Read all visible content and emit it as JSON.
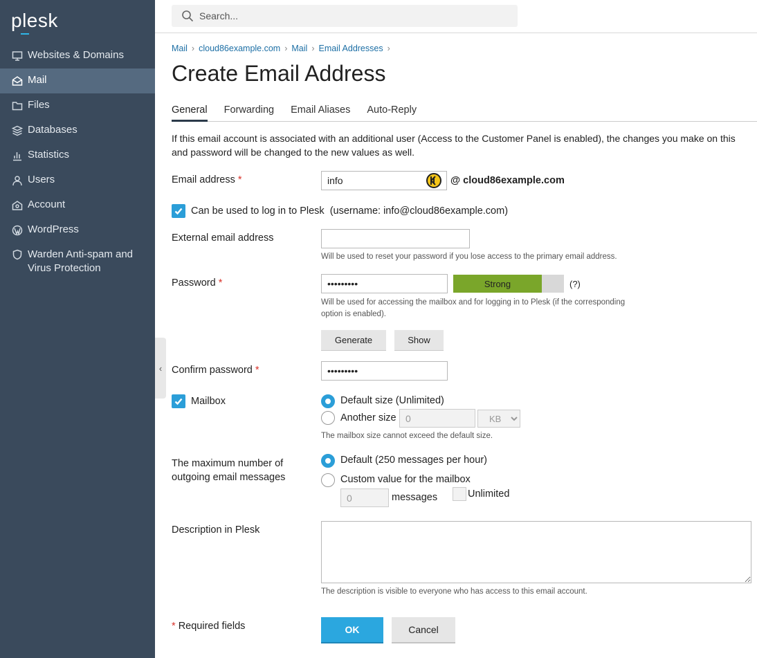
{
  "brand": {
    "logo_text": "plesk",
    "accent": "#2fb6e8"
  },
  "sidebar": {
    "items": [
      {
        "label": "Websites & Domains",
        "icon": "monitor-icon"
      },
      {
        "label": "Mail",
        "icon": "mail-icon",
        "active": true
      },
      {
        "label": "Files",
        "icon": "folder-icon"
      },
      {
        "label": "Databases",
        "icon": "database-icon"
      },
      {
        "label": "Statistics",
        "icon": "bar-chart-icon"
      },
      {
        "label": "Users",
        "icon": "user-icon"
      },
      {
        "label": "Account",
        "icon": "account-icon"
      },
      {
        "label": "WordPress",
        "icon": "wordpress-icon"
      },
      {
        "label_line1": "Warden Anti-spam and",
        "label_line2": "Virus Protection",
        "icon": "shield-icon"
      }
    ]
  },
  "search": {
    "placeholder": "Search..."
  },
  "breadcrumb": [
    "Mail",
    "cloud86example.com",
    "Mail",
    "Email Addresses"
  ],
  "page_title": "Create Email Address",
  "tabs": [
    "General",
    "Forwarding",
    "Email Aliases",
    "Auto-Reply"
  ],
  "intro_line1": "If this email account is associated with an additional user (Access to the Customer Panel is enabled), the changes you make on this",
  "intro_line2": "and password will be changed to the new values as well.",
  "form": {
    "email_label": "Email address",
    "required_mark": "*",
    "email_value": "info",
    "email_domain": "@ cloud86example.com",
    "login_checkbox_label": "Can be used to log in to Plesk  (username: info@cloud86example.com)",
    "external_label": "External email address",
    "external_value": "",
    "external_hint": "Will be used to reset your password if you lose access to the primary email address.",
    "password_label": "Password",
    "password_value": "•••••••••",
    "strength_label": "Strong",
    "strength_fraction": 0.8,
    "strength_help": "(?)",
    "password_hint_line1": "Will be used for accessing the mailbox and for logging in to Plesk (if the corresponding",
    "password_hint_line2": "option is enabled).",
    "generate_label": "Generate",
    "show_label": "Show",
    "confirm_label": "Confirm password",
    "confirm_value": "•••••••••",
    "mailbox_label": "Mailbox",
    "mailbox_default": "Default size (Unlimited)",
    "mailbox_another": "Another size",
    "mailbox_size_value": "0",
    "mailbox_unit": "KB",
    "mailbox_hint": "The mailbox size cannot exceed the default size.",
    "outgoing_label_line1": "The maximum number of",
    "outgoing_label_line2": "outgoing email messages",
    "outgoing_default": "Default (250 messages per hour)",
    "outgoing_custom": "Custom value for the mailbox",
    "outgoing_value": "0",
    "outgoing_unit": "messages",
    "unlimited_label": "Unlimited",
    "description_label": "Description in Plesk",
    "description_hint": "The description is visible to everyone who has access to this email account.",
    "required_fields_label": "Required fields",
    "ok_label": "OK",
    "cancel_label": "Cancel"
  }
}
